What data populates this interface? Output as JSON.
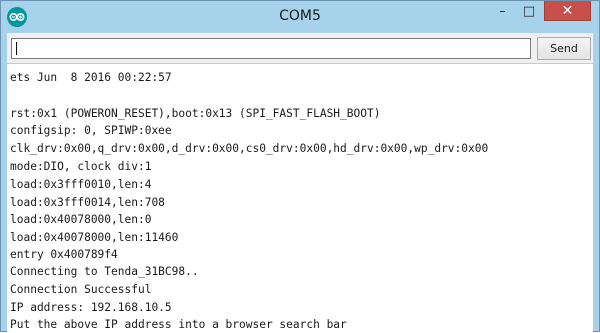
{
  "window": {
    "title": "COM5",
    "controls": {
      "minimize": "–",
      "maximize": "□",
      "close": "✕"
    }
  },
  "toolbar": {
    "input_value": "",
    "send_label": "Send"
  },
  "console": {
    "lines": [
      "ets Jun  8 2016 00:22:57",
      "",
      "rst:0x1 (POWERON_RESET),boot:0x13 (SPI_FAST_FLASH_BOOT)",
      "configsip: 0, SPIWP:0xee",
      "clk_drv:0x00,q_drv:0x00,d_drv:0x00,cs0_drv:0x00,hd_drv:0x00,wp_drv:0x00",
      "mode:DIO, clock div:1",
      "load:0x3fff0010,len:4",
      "load:0x3fff0014,len:708",
      "load:0x40078000,len:0",
      "load:0x40078000,len:11460",
      "entry 0x400789f4",
      "Connecting to Tenda_31BC98..",
      "Connection Successful",
      "IP address: 192.168.10.5",
      "Put the above IP address into a browser search bar"
    ]
  },
  "colors": {
    "titlebar": "#a7d2ec",
    "close_button": "#c7504a",
    "app_icon": "#00979c"
  }
}
